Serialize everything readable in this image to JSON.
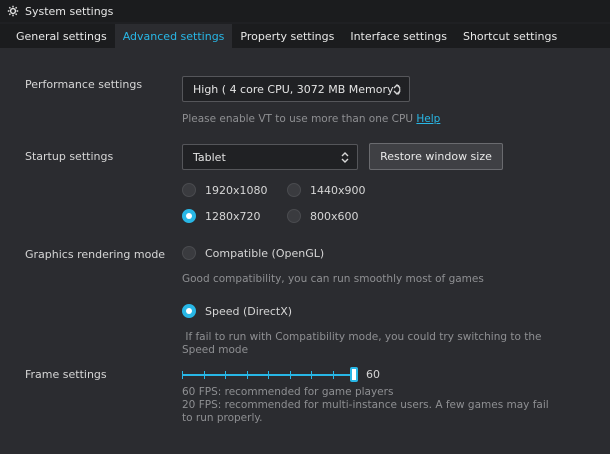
{
  "window": {
    "title": "System settings",
    "icon": "gear-icon"
  },
  "tabs": [
    {
      "label": "General settings",
      "active": false
    },
    {
      "label": "Advanced settings",
      "active": true
    },
    {
      "label": "Property settings",
      "active": false
    },
    {
      "label": "Interface settings",
      "active": false
    },
    {
      "label": "Shortcut settings",
      "active": false
    }
  ],
  "performance": {
    "label": "Performance settings",
    "selected": "High ( 4 core CPU, 3072 MB Memory )",
    "hint_text": "Please enable VT to use more than one CPU",
    "hint_link": "Help"
  },
  "startup": {
    "label": "Startup settings",
    "selected": "Tablet",
    "restore_button": "Restore window size",
    "resolutions": [
      {
        "label": "1920x1080",
        "selected": false
      },
      {
        "label": "1440x900",
        "selected": false
      },
      {
        "label": "1280x720",
        "selected": true
      },
      {
        "label": "800x600",
        "selected": false
      }
    ]
  },
  "graphics": {
    "label": "Graphics rendering mode",
    "options": [
      {
        "label": "Compatible (OpenGL)",
        "selected": false,
        "hint": "Good compatibility, you can run smoothly most of games"
      },
      {
        "label": "Speed (DirectX)",
        "selected": true,
        "hint": " If fail to run with Compatibility mode, you could try switching to the Speed mode"
      }
    ]
  },
  "frame": {
    "label": "Frame settings",
    "value": "60",
    "min": 0,
    "max": 60,
    "hint1": "60 FPS: recommended for game players",
    "hint2": "20 FPS: recommended for multi-instance users. A few games may fail to run properly."
  },
  "colors": {
    "accent": "#28b7e6",
    "background": "#2b2c30",
    "titlebar": "#1b1c1e"
  }
}
